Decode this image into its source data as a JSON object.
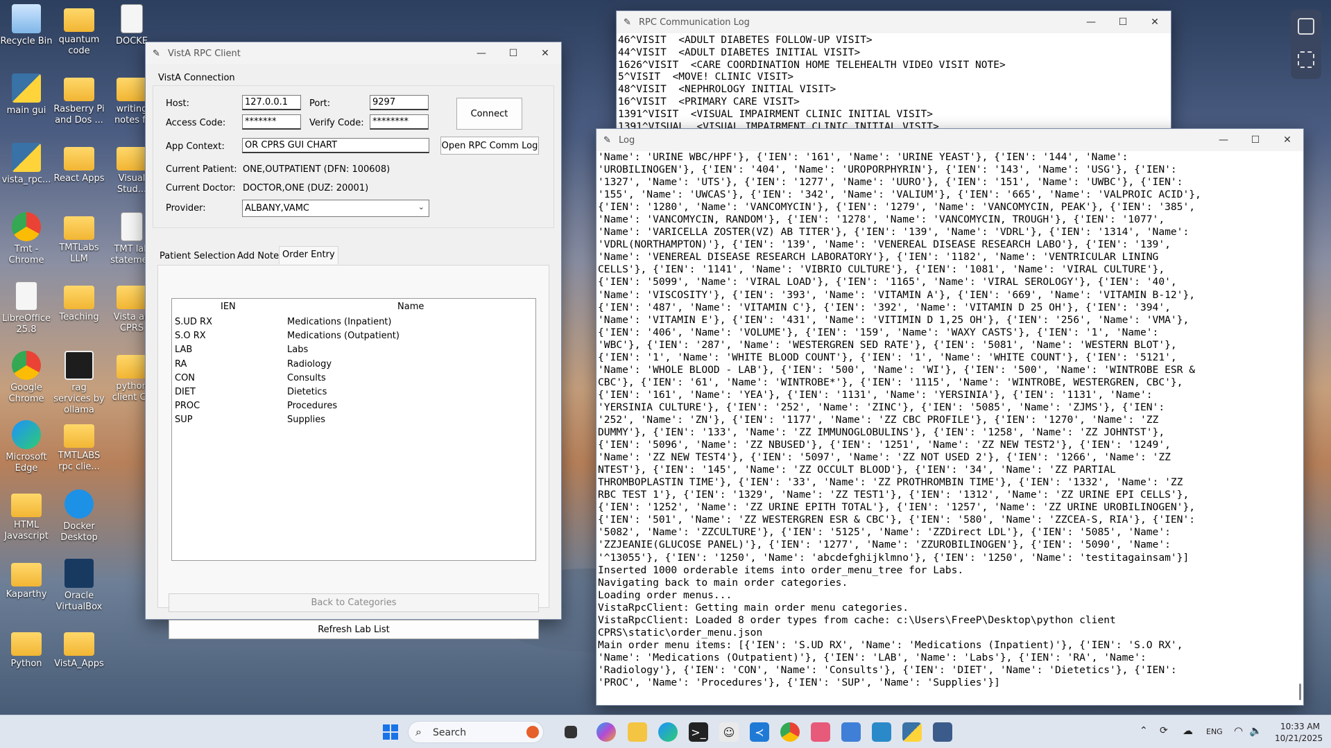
{
  "desktop": {
    "icons": [
      {
        "label": "Recycle Bin"
      },
      {
        "label": "quantum code"
      },
      {
        "label": "DOCKE"
      },
      {
        "label": "main gui"
      },
      {
        "label": "Rasberry Pi and Dos ..."
      },
      {
        "label": "writing notes fr"
      },
      {
        "label": "vista_rpc..."
      },
      {
        "label": "React Apps"
      },
      {
        "label": "Visual Stud..."
      },
      {
        "label": "Tmt - Chrome"
      },
      {
        "label": "TMTLabs LLM"
      },
      {
        "label": "TMT lab statemen"
      },
      {
        "label": "LibreOffice 25.8"
      },
      {
        "label": "Teaching"
      },
      {
        "label": "Vista an CPRS"
      },
      {
        "label": "Google Chrome"
      },
      {
        "label": "rag services by ollama"
      },
      {
        "label": "python client CP"
      },
      {
        "label": "Microsoft Edge"
      },
      {
        "label": "TMTLABS rpc clie..."
      },
      {
        "label": "HTML Javascript"
      },
      {
        "label": "Docker Desktop"
      },
      {
        "label": "Kaparthy"
      },
      {
        "label": "Oracle VirtualBox"
      },
      {
        "label": "Python"
      },
      {
        "label": "VistA_Apps"
      }
    ]
  },
  "rpc_log_window": {
    "title": "RPC Communication Log",
    "lines": [
      "46^VISIT  <ADULT DIABETES FOLLOW-UP VISIT>",
      "44^VISIT  <ADULT DIABETES INITIAL VISIT>",
      "1626^VISIT  <CARE COORDINATION HOME TELEHEALTH VIDEO VISIT NOTE>",
      "5^VISIT  <MOVE! CLINIC VISIT>",
      "48^VISIT  <NEPHROLOGY INITIAL VISIT>",
      "16^VISIT  <PRIMARY CARE VISIT>",
      "1391^VISIT  <VISUAL IMPAIRMENT CLINIC INITIAL VISIT>",
      "1391^VISUAL  <VISUAL IMPAIRMENT CLINIC INITIAL VISIT>"
    ]
  },
  "vista_window": {
    "title": "VistA RPC Client",
    "group_label": "VistA Connection",
    "host_label": "Host:",
    "host_value": "127.0.0.1",
    "port_label": "Port:",
    "port_value": "9297",
    "access_label": "Access Code:",
    "access_value": "*******",
    "verify_label": "Verify Code:",
    "verify_value": "********",
    "connect_label": "Connect",
    "app_context_label": "App Context:",
    "app_context_value": "OR CPRS GUI CHART",
    "open_log_label": "Open RPC Comm Log",
    "patient_label": "Current Patient:",
    "patient_value": "ONE,OUTPATIENT (DFN: 100608)",
    "doctor_label": "Current Doctor:",
    "doctor_value": "DOCTOR,ONE (DUZ: 20001)",
    "provider_label": "Provider:",
    "provider_value": "ALBANY,VAMC",
    "tabs": [
      "Patient Selection",
      "Add Note",
      "Order Entry"
    ],
    "table_headers": [
      "IEN",
      "Name"
    ],
    "rows": [
      {
        "ien": "S.UD RX",
        "name": "Medications (Inpatient)"
      },
      {
        "ien": "S.O RX",
        "name": "Medications (Outpatient)"
      },
      {
        "ien": "LAB",
        "name": "Labs"
      },
      {
        "ien": "RA",
        "name": "Radiology"
      },
      {
        "ien": "CON",
        "name": "Consults"
      },
      {
        "ien": "DIET",
        "name": "Dietetics"
      },
      {
        "ien": "PROC",
        "name": "Procedures"
      },
      {
        "ien": "SUP",
        "name": "Supplies"
      }
    ],
    "back_label": "Back to Categories",
    "refresh_label": "Refresh Lab List"
  },
  "log_window": {
    "title": "Log",
    "lines": [
      "'Name': 'URINE WBC/HPF'}, {'IEN': '161', 'Name': 'URINE YEAST'}, {'IEN': '144', 'Name':",
      "'UROBILINOGEN'}, {'IEN': '404', 'Name': 'UROPORPHYRIN'}, {'IEN': '143', 'Name': 'USG'}, {'IEN':",
      "'1327', 'Name': 'UTS'}, {'IEN': '1277', 'Name': 'UURO'}, {'IEN': '151', 'Name': 'UWBC'}, {'IEN':",
      "'155', 'Name': 'UWCAS'}, {'IEN': '342', 'Name': 'VALIUM'}, {'IEN': '665', 'Name': 'VALPROIC ACID'},",
      "{'IEN': '1280', 'Name': 'VANCOMYCIN'}, {'IEN': '1279', 'Name': 'VANCOMYCIN, PEAK'}, {'IEN': '385',",
      "'Name': 'VANCOMYCIN, RANDOM'}, {'IEN': '1278', 'Name': 'VANCOMYCIN, TROUGH'}, {'IEN': '1077',",
      "'Name': 'VARICELLA ZOSTER(VZ) AB TITER'}, {'IEN': '139', 'Name': 'VDRL'}, {'IEN': '1314', 'Name':",
      "'VDRL(NORTHAMPTON)'}, {'IEN': '139', 'Name': 'VENEREAL DISEASE RESEARCH LABO'}, {'IEN': '139',",
      "'Name': 'VENEREAL DISEASE RESEARCH LABORATORY'}, {'IEN': '1182', 'Name': 'VENTRICULAR LINING",
      "CELLS'}, {'IEN': '1141', 'Name': 'VIBRIO CULTURE'}, {'IEN': '1081', 'Name': 'VIRAL CULTURE'},",
      "{'IEN': '5099', 'Name': 'VIRAL LOAD'}, {'IEN': '1165', 'Name': 'VIRAL SEROLOGY'}, {'IEN': '40',",
      "'Name': 'VISCOSITY'}, {'IEN': '393', 'Name': 'VITAMIN A'}, {'IEN': '669', 'Name': 'VITAMIN B-12'},",
      "{'IEN': '487', 'Name': 'VITAMIN C'}, {'IEN': '392', 'Name': 'VITAMIN D 25 OH'}, {'IEN': '394',",
      "'Name': 'VITAMIN E'}, {'IEN': '431', 'Name': 'VITIMIN D 1,25 OH'}, {'IEN': '256', 'Name': 'VMA'},",
      "{'IEN': '406', 'Name': 'VOLUME'}, {'IEN': '159', 'Name': 'WAXY CASTS'}, {'IEN': '1', 'Name':",
      "'WBC'}, {'IEN': '287', 'Name': 'WESTERGREN SED RATE'}, {'IEN': '5081', 'Name': 'WESTERN BLOT'},",
      "{'IEN': '1', 'Name': 'WHITE BLOOD COUNT'}, {'IEN': '1', 'Name': 'WHITE COUNT'}, {'IEN': '5121',",
      "'Name': 'WHOLE BLOOD - LAB'}, {'IEN': '500', 'Name': 'WI'}, {'IEN': '500', 'Name': 'WINTROBE ESR &",
      "CBC'}, {'IEN': '61', 'Name': 'WINTROBE*'}, {'IEN': '1115', 'Name': 'WINTROBE, WESTERGREN, CBC'},",
      "{'IEN': '161', 'Name': 'YEA'}, {'IEN': '1131', 'Name': 'YERSINIA'}, {'IEN': '1131', 'Name':",
      "'YERSINIA CULTURE'}, {'IEN': '252', 'Name': 'ZINC'}, {'IEN': '5085', 'Name': 'ZJMS'}, {'IEN':",
      "'252', 'Name': 'ZN'}, {'IEN': '1177', 'Name': 'ZZ CBC PROFILE'}, {'IEN': '1270', 'Name': 'ZZ",
      "DUMMY'}, {'IEN': '133', 'Name': 'ZZ IMMUNOGLOBULINS'}, {'IEN': '1258', 'Name': 'ZZ JOHNTST'},",
      "{'IEN': '5096', 'Name': 'ZZ NBUSED'}, {'IEN': '1251', 'Name': 'ZZ NEW TEST2'}, {'IEN': '1249',",
      "'Name': 'ZZ NEW TEST4'}, {'IEN': '5097', 'Name': 'ZZ NOT USED 2'}, {'IEN': '1266', 'Name': 'ZZ",
      "NTEST'}, {'IEN': '145', 'Name': 'ZZ OCCULT BLOOD'}, {'IEN': '34', 'Name': 'ZZ PARTIAL",
      "THROMBOPLASTIN TIME'}, {'IEN': '33', 'Name': 'ZZ PROTHROMBIN TIME'}, {'IEN': '1332', 'Name': 'ZZ",
      "RBC TEST 1'}, {'IEN': '1329', 'Name': 'ZZ TEST1'}, {'IEN': '1312', 'Name': 'ZZ URINE EPI CELLS'},",
      "{'IEN': '1252', 'Name': 'ZZ URINE EPITH TOTAL'}, {'IEN': '1257', 'Name': 'ZZ URINE UROBILINOGEN'},",
      "{'IEN': '501', 'Name': 'ZZ WESTERGREN ESR & CBC'}, {'IEN': '580', 'Name': 'ZZCEA-S, RIA'}, {'IEN':",
      "'5082', 'Name': 'ZZCULTURE'}, {'IEN': '5125', 'Name': 'ZZDirect LDL'}, {'IEN': '5085', 'Name':",
      "'ZZJEANIE(GLUCOSE PANEL)'}, {'IEN': '1277', 'Name': 'ZZUROBILINOGEN'}, {'IEN': '5090', 'Name':",
      "'^13055'}, {'IEN': '1250', 'Name': 'abcdefghijklmno'}, {'IEN': '1250', 'Name': 'testitagainsam'}]",
      "Inserted 1000 orderable items into order_menu_tree for Labs.",
      "Navigating back to main order categories.",
      "Loading order menus...",
      "VistaRpcClient: Getting main order menu categories.",
      "VistaRpcClient: Loaded 8 order types from cache: c:\\Users\\FreeP\\Desktop\\python client",
      "CPRS\\static\\order_menu.json",
      "Main order menu items: [{'IEN': 'S.UD RX', 'Name': 'Medications (Inpatient)'}, {'IEN': 'S.O RX',",
      "'Name': 'Medications (Outpatient)'}, {'IEN': 'LAB', 'Name': 'Labs'}, {'IEN': 'RA', 'Name':",
      "'Radiology'}, {'IEN': 'CON', 'Name': 'Consults'}, {'IEN': 'DIET', 'Name': 'Dietetics'}, {'IEN':",
      "'PROC', 'Name': 'Procedures'}, {'IEN': 'SUP', 'Name': 'Supplies'}]"
    ]
  },
  "taskbar": {
    "search_placeholder": "Search",
    "language": "ENG",
    "time": "10:33 AM",
    "date": "10/21/2025"
  }
}
